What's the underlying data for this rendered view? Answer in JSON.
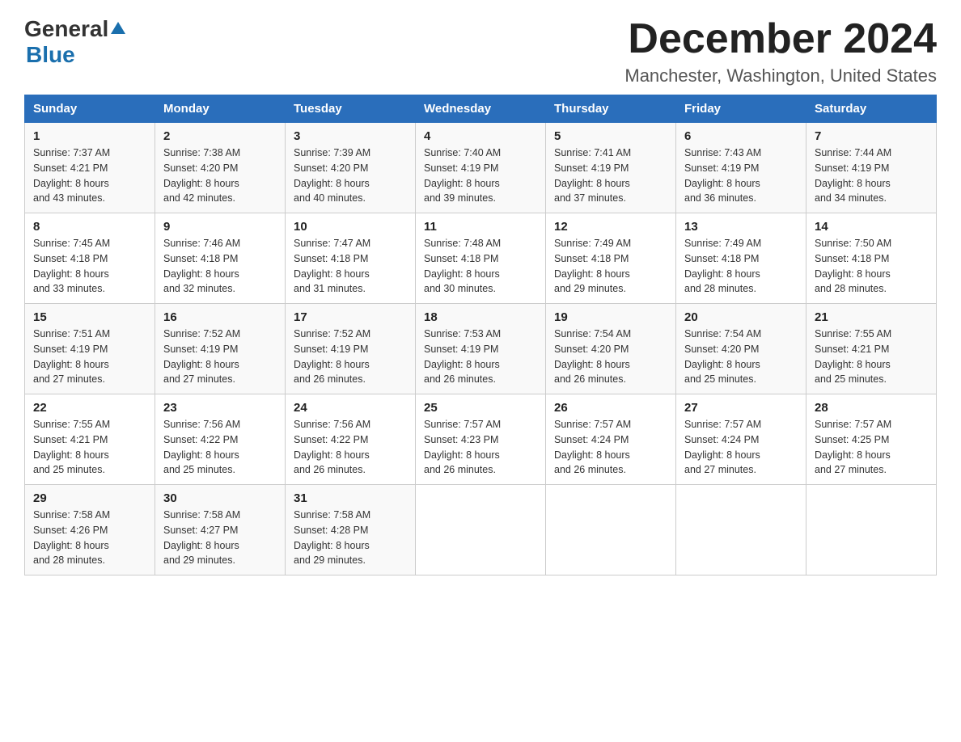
{
  "header": {
    "logo_general": "General",
    "logo_blue": "Blue",
    "month_title": "December 2024",
    "location": "Manchester, Washington, United States"
  },
  "weekdays": [
    "Sunday",
    "Monday",
    "Tuesday",
    "Wednesday",
    "Thursday",
    "Friday",
    "Saturday"
  ],
  "weeks": [
    [
      {
        "day": "1",
        "sunrise": "7:37 AM",
        "sunset": "4:21 PM",
        "daylight": "8 hours and 43 minutes."
      },
      {
        "day": "2",
        "sunrise": "7:38 AM",
        "sunset": "4:20 PM",
        "daylight": "8 hours and 42 minutes."
      },
      {
        "day": "3",
        "sunrise": "7:39 AM",
        "sunset": "4:20 PM",
        "daylight": "8 hours and 40 minutes."
      },
      {
        "day": "4",
        "sunrise": "7:40 AM",
        "sunset": "4:19 PM",
        "daylight": "8 hours and 39 minutes."
      },
      {
        "day": "5",
        "sunrise": "7:41 AM",
        "sunset": "4:19 PM",
        "daylight": "8 hours and 37 minutes."
      },
      {
        "day": "6",
        "sunrise": "7:43 AM",
        "sunset": "4:19 PM",
        "daylight": "8 hours and 36 minutes."
      },
      {
        "day": "7",
        "sunrise": "7:44 AM",
        "sunset": "4:19 PM",
        "daylight": "8 hours and 34 minutes."
      }
    ],
    [
      {
        "day": "8",
        "sunrise": "7:45 AM",
        "sunset": "4:18 PM",
        "daylight": "8 hours and 33 minutes."
      },
      {
        "day": "9",
        "sunrise": "7:46 AM",
        "sunset": "4:18 PM",
        "daylight": "8 hours and 32 minutes."
      },
      {
        "day": "10",
        "sunrise": "7:47 AM",
        "sunset": "4:18 PM",
        "daylight": "8 hours and 31 minutes."
      },
      {
        "day": "11",
        "sunrise": "7:48 AM",
        "sunset": "4:18 PM",
        "daylight": "8 hours and 30 minutes."
      },
      {
        "day": "12",
        "sunrise": "7:49 AM",
        "sunset": "4:18 PM",
        "daylight": "8 hours and 29 minutes."
      },
      {
        "day": "13",
        "sunrise": "7:49 AM",
        "sunset": "4:18 PM",
        "daylight": "8 hours and 28 minutes."
      },
      {
        "day": "14",
        "sunrise": "7:50 AM",
        "sunset": "4:18 PM",
        "daylight": "8 hours and 28 minutes."
      }
    ],
    [
      {
        "day": "15",
        "sunrise": "7:51 AM",
        "sunset": "4:19 PM",
        "daylight": "8 hours and 27 minutes."
      },
      {
        "day": "16",
        "sunrise": "7:52 AM",
        "sunset": "4:19 PM",
        "daylight": "8 hours and 27 minutes."
      },
      {
        "day": "17",
        "sunrise": "7:52 AM",
        "sunset": "4:19 PM",
        "daylight": "8 hours and 26 minutes."
      },
      {
        "day": "18",
        "sunrise": "7:53 AM",
        "sunset": "4:19 PM",
        "daylight": "8 hours and 26 minutes."
      },
      {
        "day": "19",
        "sunrise": "7:54 AM",
        "sunset": "4:20 PM",
        "daylight": "8 hours and 26 minutes."
      },
      {
        "day": "20",
        "sunrise": "7:54 AM",
        "sunset": "4:20 PM",
        "daylight": "8 hours and 25 minutes."
      },
      {
        "day": "21",
        "sunrise": "7:55 AM",
        "sunset": "4:21 PM",
        "daylight": "8 hours and 25 minutes."
      }
    ],
    [
      {
        "day": "22",
        "sunrise": "7:55 AM",
        "sunset": "4:21 PM",
        "daylight": "8 hours and 25 minutes."
      },
      {
        "day": "23",
        "sunrise": "7:56 AM",
        "sunset": "4:22 PM",
        "daylight": "8 hours and 25 minutes."
      },
      {
        "day": "24",
        "sunrise": "7:56 AM",
        "sunset": "4:22 PM",
        "daylight": "8 hours and 26 minutes."
      },
      {
        "day": "25",
        "sunrise": "7:57 AM",
        "sunset": "4:23 PM",
        "daylight": "8 hours and 26 minutes."
      },
      {
        "day": "26",
        "sunrise": "7:57 AM",
        "sunset": "4:24 PM",
        "daylight": "8 hours and 26 minutes."
      },
      {
        "day": "27",
        "sunrise": "7:57 AM",
        "sunset": "4:24 PM",
        "daylight": "8 hours and 27 minutes."
      },
      {
        "day": "28",
        "sunrise": "7:57 AM",
        "sunset": "4:25 PM",
        "daylight": "8 hours and 27 minutes."
      }
    ],
    [
      {
        "day": "29",
        "sunrise": "7:58 AM",
        "sunset": "4:26 PM",
        "daylight": "8 hours and 28 minutes."
      },
      {
        "day": "30",
        "sunrise": "7:58 AM",
        "sunset": "4:27 PM",
        "daylight": "8 hours and 29 minutes."
      },
      {
        "day": "31",
        "sunrise": "7:58 AM",
        "sunset": "4:28 PM",
        "daylight": "8 hours and 29 minutes."
      },
      null,
      null,
      null,
      null
    ]
  ],
  "labels": {
    "sunrise": "Sunrise:",
    "sunset": "Sunset:",
    "daylight": "Daylight:"
  }
}
